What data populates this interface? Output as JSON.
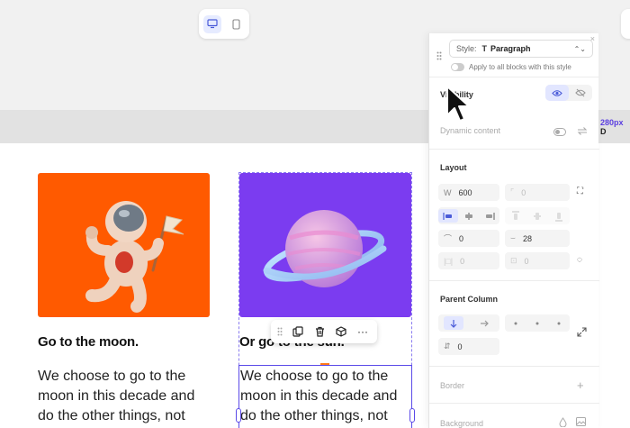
{
  "device_switch": {
    "desktop": "desktop-icon",
    "mobile": "mobile-icon",
    "active": "desktop"
  },
  "ruler": {
    "value": "280px",
    "suffix": "D"
  },
  "cards": [
    {
      "title": "Go to the moon.",
      "body": "We choose to go to the moon in this decade and do the other things, not",
      "image": "astronaut-illustration",
      "color": "#ff5a00"
    },
    {
      "title": "Or go to the sun.",
      "body": "We choose to go to the moon in this decade and do the other things, not",
      "image": "planet-illustration",
      "color": "#7b3cf0"
    }
  ],
  "block_toolbar": {
    "buttons": [
      "drag-handle-icon",
      "duplicate-icon",
      "delete-icon",
      "cube-icon",
      "more-icon"
    ],
    "more_label": "···"
  },
  "panel": {
    "close": "×",
    "style_label": "Style:",
    "style_value": "Paragraph",
    "style_icon": "T",
    "apply_label": "Apply to all blocks with this style",
    "visibility_label": "Visibility",
    "dynamic_content_label": "Dynamic content",
    "layout_label": "Layout",
    "width_prefix": "W",
    "width_value": "600",
    "radius_value": "0",
    "spacing_top_value": "0",
    "spacing_bottom_value": "28",
    "padding_value": "0",
    "padding_alt_value": "0",
    "parent_column_label": "Parent Column",
    "parent_gap_value": "0",
    "border_label": "Border",
    "border_add": "+",
    "background_label": "Background"
  },
  "colors": {
    "accent": "#5b4ae8",
    "card1": "#ff5a00",
    "card2": "#7b3cf0",
    "highlight": "#ff7a1a"
  }
}
